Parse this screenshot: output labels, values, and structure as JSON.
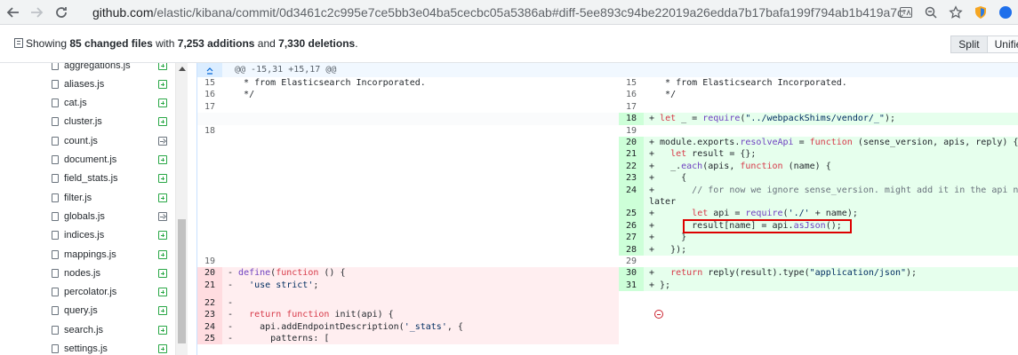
{
  "browser": {
    "url_host": "github.com",
    "url_path": "/elastic/kibana/commit/0d3461c2c995e7ce5bb3e04ba5cecbc05a5386ab#diff-5ee893c94be22019a26edda7b17bafa199f794ab1b419a7c..."
  },
  "toolbar": {
    "prefix": "Showing ",
    "files_changed": "85 changed files",
    "mid1": " with ",
    "additions": "7,253 additions",
    "mid2": " and ",
    "deletions": "7,330 deletions",
    "suffix": ".",
    "split_label": "Split",
    "unified_label": "Unified"
  },
  "file_tree": [
    {
      "name": "aggregations.js",
      "status": "added"
    },
    {
      "name": "aliases.js",
      "status": "added"
    },
    {
      "name": "cat.js",
      "status": "added"
    },
    {
      "name": "cluster.js",
      "status": "added"
    },
    {
      "name": "count.js",
      "status": "renamed"
    },
    {
      "name": "document.js",
      "status": "added"
    },
    {
      "name": "field_stats.js",
      "status": "added"
    },
    {
      "name": "filter.js",
      "status": "added"
    },
    {
      "name": "globals.js",
      "status": "renamed"
    },
    {
      "name": "indices.js",
      "status": "added"
    },
    {
      "name": "mappings.js",
      "status": "added"
    },
    {
      "name": "nodes.js",
      "status": "added"
    },
    {
      "name": "percolator.js",
      "status": "added"
    },
    {
      "name": "query.js",
      "status": "added"
    },
    {
      "name": "search.js",
      "status": "added"
    },
    {
      "name": "settings.js",
      "status": "added"
    }
  ],
  "diff": {
    "hunk_header": "@@ -15,31 +15,17 @@",
    "left": [
      {
        "n": "15",
        "t": "ctx",
        "code": "   * from Elasticsearch Incorporated."
      },
      {
        "n": "16",
        "t": "ctx",
        "code": "   */"
      },
      {
        "n": "17",
        "t": "ctx",
        "code": ""
      },
      {
        "n": "",
        "t": "empty",
        "code": ""
      },
      {
        "n": "18",
        "t": "ctx",
        "code": ""
      },
      {
        "n": "19",
        "t": "ctx",
        "code": ""
      },
      {
        "n": "20",
        "t": "del",
        "code": "- define(function () {"
      },
      {
        "n": "21",
        "t": "del",
        "code": "-   'use strict';"
      },
      {
        "n": "22",
        "t": "del",
        "code": "-"
      },
      {
        "n": "23",
        "t": "del",
        "code": "-   return function init(api) {"
      },
      {
        "n": "24",
        "t": "del",
        "code": "-     api.addEndpointDescription('_stats', {"
      },
      {
        "n": "25",
        "t": "del",
        "code": "-       patterns: ["
      }
    ],
    "right": [
      {
        "n": "15",
        "t": "ctx",
        "code": "   * from Elasticsearch Incorporated."
      },
      {
        "n": "16",
        "t": "ctx",
        "code": "   */"
      },
      {
        "n": "17",
        "t": "ctx",
        "code": ""
      },
      {
        "n": "18",
        "t": "add",
        "code": "+ let _ = require(\"../webpackShims/vendor/_\");"
      },
      {
        "n": "19",
        "t": "ctx",
        "code": ""
      },
      {
        "n": "20",
        "t": "add",
        "code": "+ module.exports.resolveApi = function (sense_version, apis, reply) {"
      },
      {
        "n": "21",
        "t": "add",
        "code": "+   let result = {};"
      },
      {
        "n": "22",
        "t": "add",
        "code": "+   _.each(apis, function (name) {"
      },
      {
        "n": "23",
        "t": "add",
        "code": "+     {"
      },
      {
        "n": "24",
        "t": "add",
        "code": "+       // for now we ignore sense_version. might add it in the api name"
      },
      {
        "n": "",
        "t": "add",
        "code": "later"
      },
      {
        "n": "25",
        "t": "add",
        "code": "+       let api = require('./' + name);"
      },
      {
        "n": "26",
        "t": "add",
        "code": "+       result[name] = api.asJson();"
      },
      {
        "n": "27",
        "t": "add",
        "code": "+     }"
      },
      {
        "n": "28",
        "t": "add",
        "code": "+   });"
      },
      {
        "n": "29",
        "t": "ctx",
        "code": ""
      },
      {
        "n": "30",
        "t": "add",
        "code": "+   return reply(result).type(\"application/json\");"
      },
      {
        "n": "31",
        "t": "add",
        "code": "+ };"
      }
    ]
  },
  "colors": {
    "added_bg": "#e6ffed",
    "deleted_bg": "#ffeef0",
    "highlight_border": "#dd0000"
  }
}
